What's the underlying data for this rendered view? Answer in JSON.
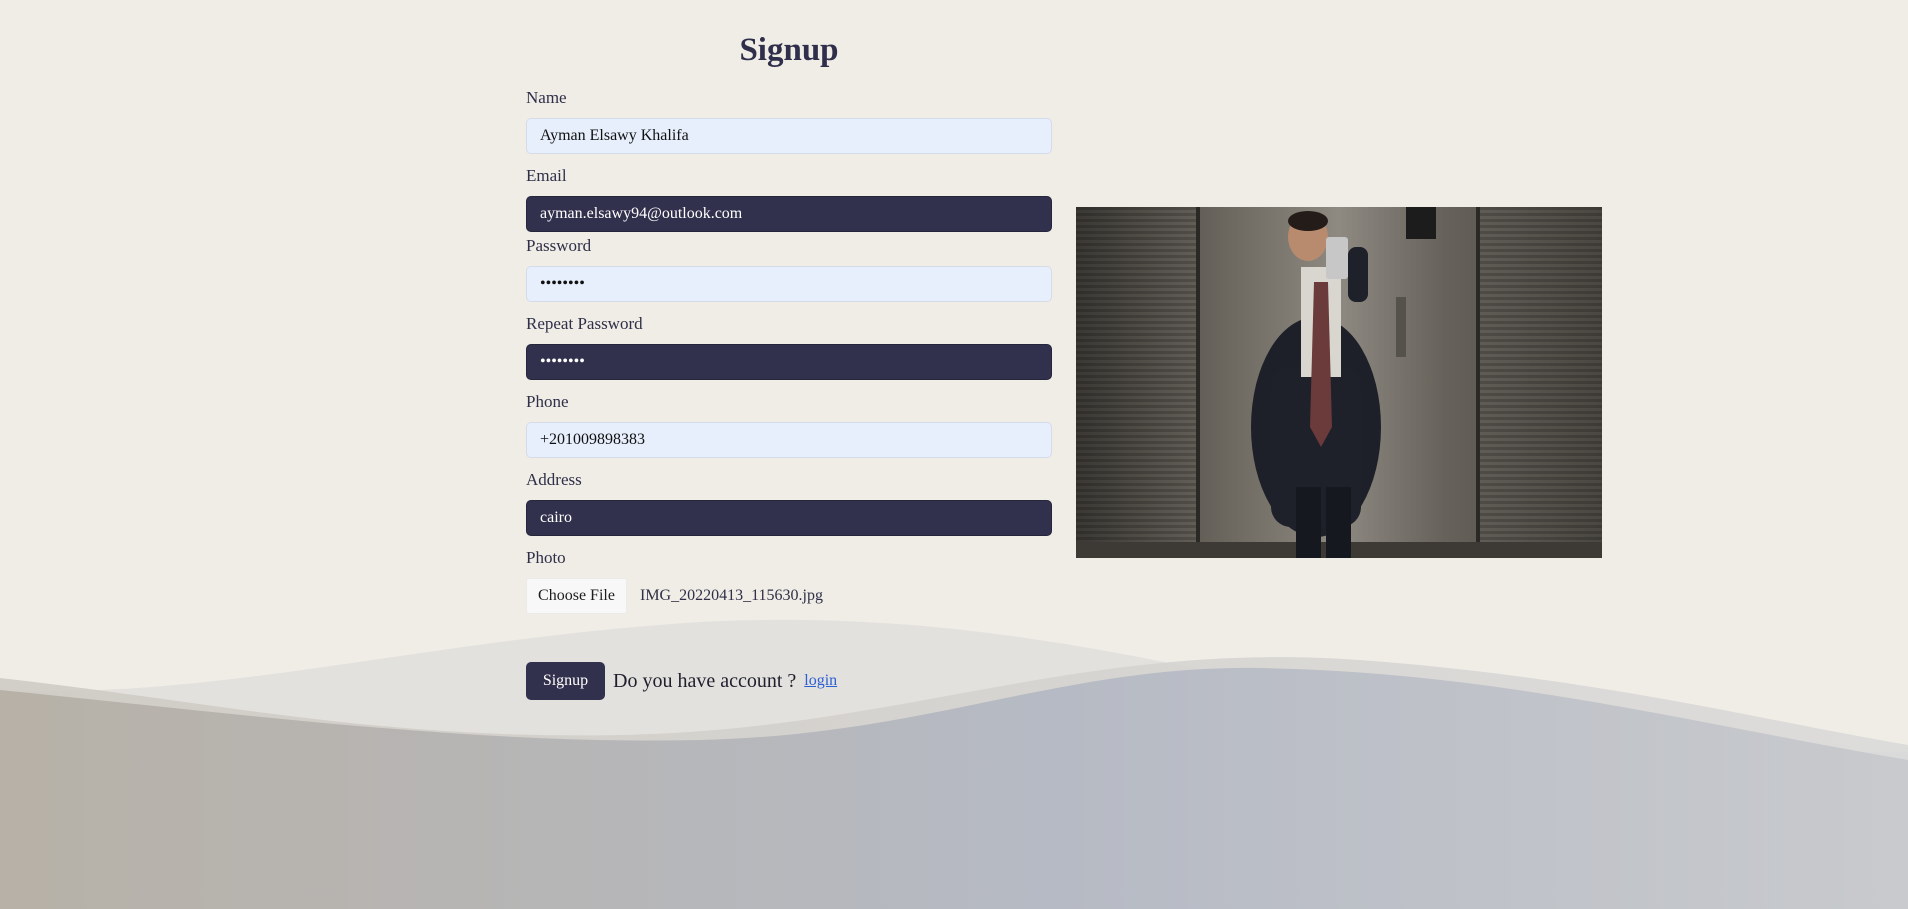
{
  "form": {
    "title": "Signup",
    "name_label": "Name",
    "name_value": "Ayman Elsawy Khalifa",
    "email_label": "Email",
    "email_value": "ayman.elsawy94@outlook.com",
    "password_label": "Password",
    "password_value": "••••••••",
    "repeat_password_label": "Repeat Password",
    "repeat_password_value": "••••••••",
    "phone_label": "Phone",
    "phone_value": "+201009898383",
    "address_label": "Address",
    "address_value": "cairo",
    "photo_label": "Photo",
    "choose_file_label": "Choose File",
    "file_name": "IMG_20220413_115630.jpg",
    "signup_button": "Signup",
    "account_question": "Do you have account ?",
    "login_link": "login"
  },
  "colors": {
    "background": "#f0ece6",
    "accent_dark": "#31314d",
    "input_light": "#e7effc",
    "link": "#2a5fd4"
  }
}
